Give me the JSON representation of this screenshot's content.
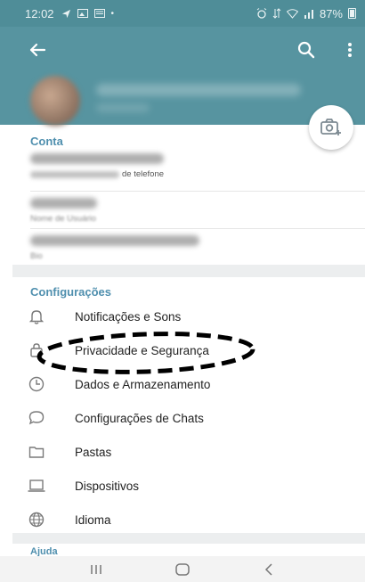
{
  "status_bar": {
    "time": "12:02",
    "battery": "87%"
  },
  "header": {
    "name": "",
    "subtitle": ""
  },
  "account": {
    "title": "Conta",
    "phone": {
      "value": "+55 (11) 98871 3343",
      "caption_blur": "Toque para alterar o número",
      "caption_plain": "de telefone"
    },
    "username": {
      "value": "@usuario",
      "caption": "Nome de Usuário"
    },
    "bio": {
      "value": "@linkedin.com/certificado",
      "caption": "Bio"
    }
  },
  "settings": {
    "title": "Configurações",
    "items": [
      {
        "label": "Notificações e Sons",
        "icon": "bell-icon"
      },
      {
        "label": "Privacidade e Segurança",
        "icon": "lock-icon"
      },
      {
        "label": "Dados e Armazenamento",
        "icon": "clock-icon"
      },
      {
        "label": "Configurações de Chats",
        "icon": "chat-bubble-icon"
      },
      {
        "label": "Pastas",
        "icon": "folder-icon"
      },
      {
        "label": "Dispositivos",
        "icon": "laptop-icon"
      },
      {
        "label": "Idioma",
        "icon": "globe-icon"
      }
    ]
  },
  "help": {
    "title": "Ajuda"
  },
  "colors": {
    "header": "#5794a0",
    "status_bar": "#4f8d98",
    "section_title": "#4f8fae"
  }
}
